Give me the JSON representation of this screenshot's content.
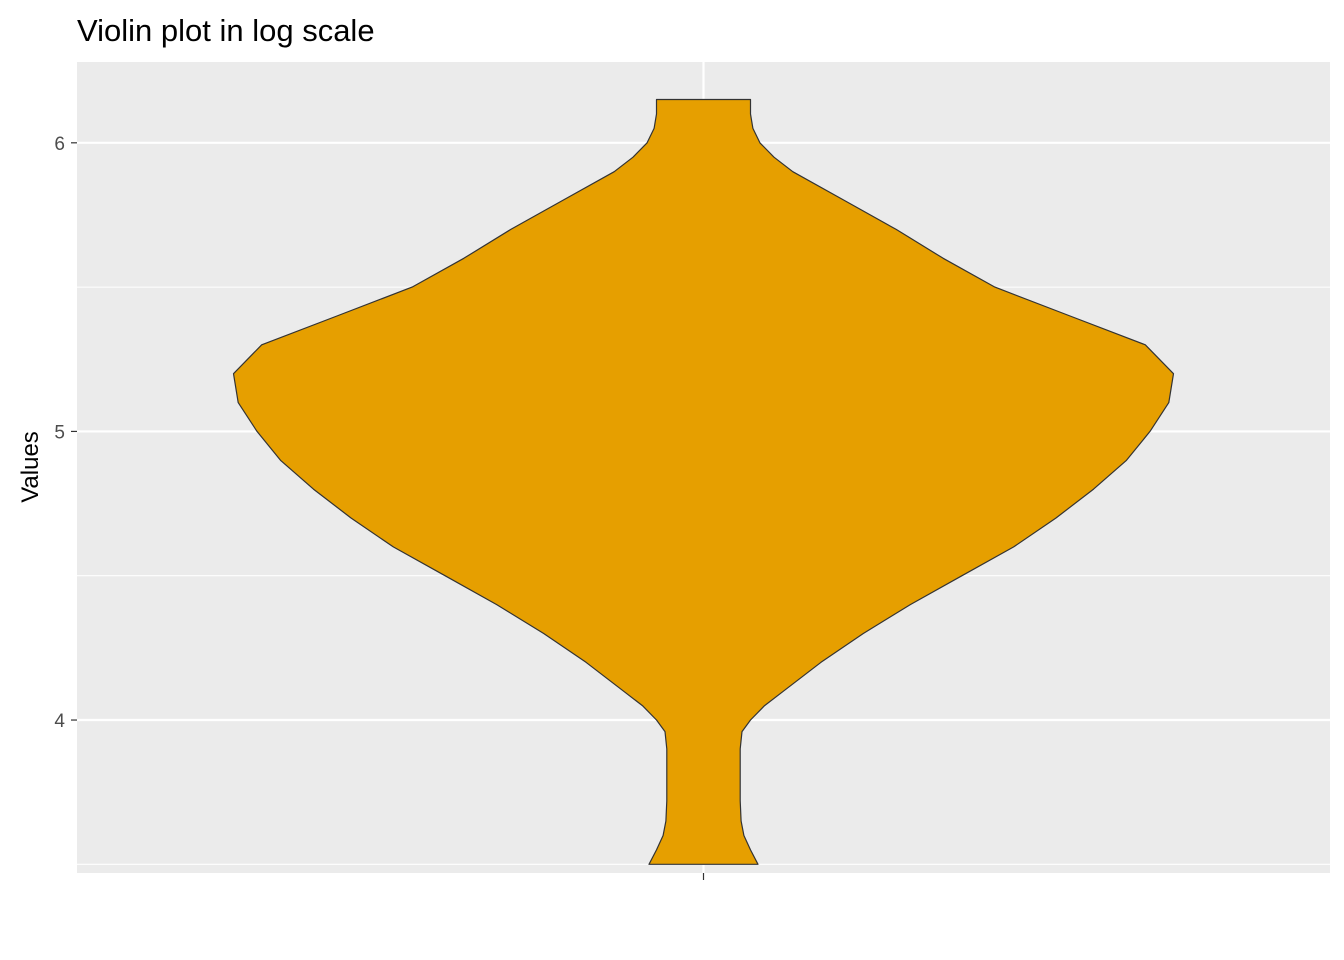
{
  "chart_data": {
    "type": "violin",
    "title": "Violin plot in log scale",
    "xlabel": "",
    "ylabel": "Values",
    "ylim": [
      3.47,
      6.28
    ],
    "yticks": [
      4,
      5,
      6
    ],
    "ytick_labels": [
      "4",
      "5",
      "6"
    ],
    "categories": [
      ""
    ],
    "grid": true,
    "legend": "none",
    "colors": {
      "fill": "#E69F00",
      "outline": "#333333",
      "panel": "#EBEBEB",
      "grid": "#FFFFFF"
    },
    "density": [
      [
        3.5,
        0.116
      ],
      [
        3.55,
        0.1
      ],
      [
        3.6,
        0.086
      ],
      [
        3.65,
        0.08
      ],
      [
        3.72,
        0.078
      ],
      [
        3.9,
        0.078
      ],
      [
        3.96,
        0.082
      ],
      [
        4.0,
        0.1
      ],
      [
        4.05,
        0.13
      ],
      [
        4.1,
        0.17
      ],
      [
        4.2,
        0.25
      ],
      [
        4.3,
        0.34
      ],
      [
        4.4,
        0.44
      ],
      [
        4.5,
        0.55
      ],
      [
        4.6,
        0.66
      ],
      [
        4.7,
        0.75
      ],
      [
        4.8,
        0.83
      ],
      [
        4.9,
        0.9
      ],
      [
        5.0,
        0.95
      ],
      [
        5.1,
        0.99
      ],
      [
        5.2,
        1.0
      ],
      [
        5.3,
        0.94
      ],
      [
        5.4,
        0.78
      ],
      [
        5.5,
        0.62
      ],
      [
        5.6,
        0.51
      ],
      [
        5.7,
        0.41
      ],
      [
        5.8,
        0.3
      ],
      [
        5.9,
        0.19
      ],
      [
        5.95,
        0.15
      ],
      [
        6.0,
        0.12
      ],
      [
        6.05,
        0.105
      ],
      [
        6.1,
        0.1
      ],
      [
        6.15,
        0.1
      ]
    ]
  }
}
